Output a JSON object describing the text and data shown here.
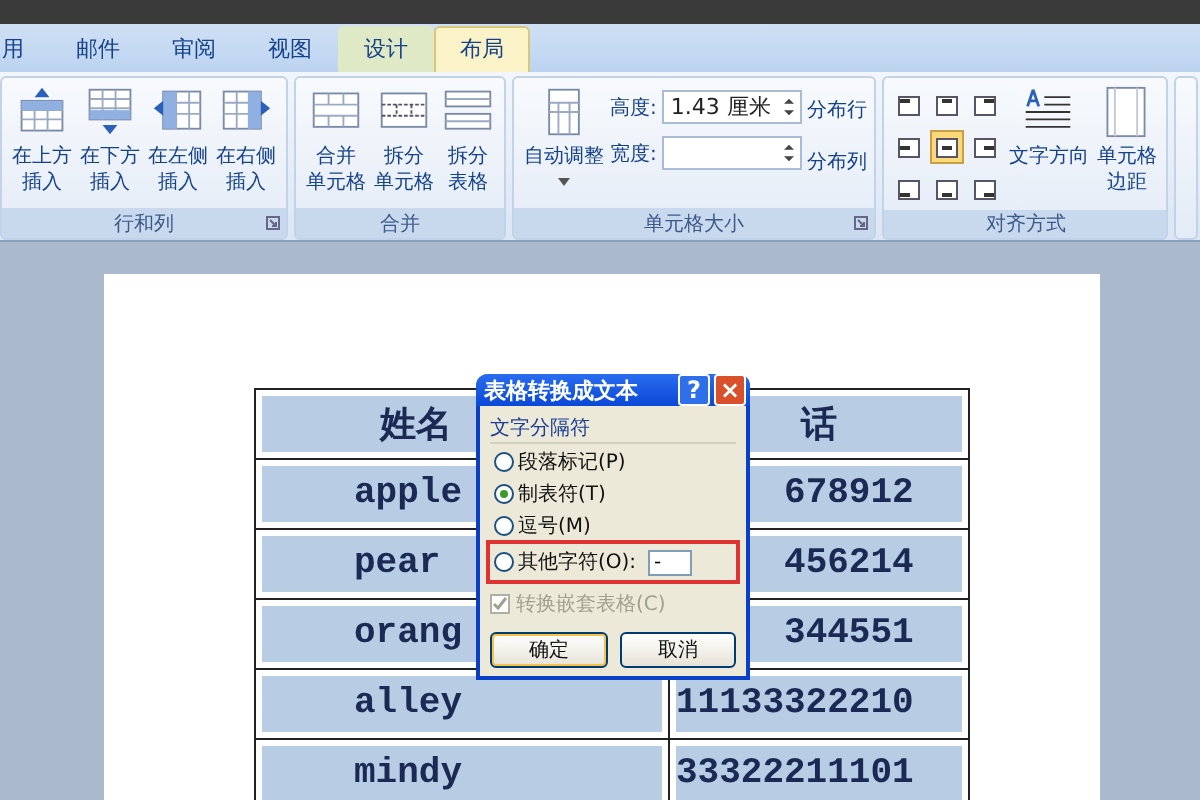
{
  "tabs": [
    {
      "label": "用",
      "selected": false,
      "context": false
    },
    {
      "label": "邮件",
      "selected": false,
      "context": false
    },
    {
      "label": "审阅",
      "selected": false,
      "context": false
    },
    {
      "label": "视图",
      "selected": false,
      "context": false
    },
    {
      "label": "设计",
      "selected": false,
      "context": true
    },
    {
      "label": "布局",
      "selected": true,
      "context": true
    }
  ],
  "ribbon": {
    "groups": [
      {
        "kind": "buttons",
        "label": "行和列",
        "items": [
          {
            "lines": [
              "在上方",
              "插入"
            ]
          },
          {
            "lines": [
              "在下方",
              "插入"
            ]
          },
          {
            "lines": [
              "在左侧",
              "插入"
            ]
          },
          {
            "lines": [
              "在右侧",
              "插入"
            ]
          }
        ]
      },
      {
        "kind": "buttons",
        "label": "合并",
        "items": [
          {
            "lines": [
              "合并",
              "单元格"
            ]
          },
          {
            "lines": [
              "拆分",
              "单元格"
            ]
          },
          {
            "lines": [
              "拆分",
              "表格"
            ]
          }
        ]
      },
      {
        "kind": "size",
        "label": "单元格大小",
        "autofit": "自动调整",
        "fields": [
          {
            "label": "高度:",
            "value": "1.43 厘米"
          },
          {
            "label": "宽度:"
          }
        ],
        "distribute": [
          "分布行",
          "分布列"
        ]
      },
      {
        "kind": "align",
        "label": "对齐方式",
        "cells": [
          {
            "selected": false
          },
          {
            "selected": false
          },
          {
            "selected": false
          },
          {
            "selected": false
          },
          {
            "selected": true
          },
          {
            "selected": false
          },
          {
            "selected": false
          },
          {
            "selected": false
          },
          {
            "selected": false
          }
        ],
        "items": [
          {
            "lines": [
              "文字方向"
            ]
          },
          {
            "lines": [
              "单元格",
              "边距"
            ]
          }
        ]
      }
    ]
  },
  "table": {
    "rows": [
      {
        "header": true,
        "cells": [
          "姓名",
          "话"
        ]
      },
      {
        "header": false,
        "cells": [
          "apple",
          "678912"
        ]
      },
      {
        "header": false,
        "cells": [
          "pear",
          "456214"
        ]
      },
      {
        "header": false,
        "cells": [
          "orang",
          "344551"
        ]
      },
      {
        "header": false,
        "cells": [
          "alley",
          "11133322210"
        ]
      },
      {
        "header": false,
        "cells": [
          "mindy",
          "33322211101"
        ]
      }
    ]
  },
  "dialog": {
    "title": "表格转换成文本",
    "help": "?",
    "close": "×",
    "group": "文字分隔符",
    "options": [
      {
        "label": "段落标记(P)",
        "selected": false,
        "highlighted": false
      },
      {
        "label": "制表符(T)",
        "selected": true,
        "highlighted": false
      },
      {
        "label": "逗号(M)",
        "selected": false,
        "highlighted": false
      },
      {
        "label": "其他字符(O):",
        "selected": false,
        "highlighted": true,
        "value": "-"
      }
    ],
    "nested": {
      "label": "转换嵌套表格(C)",
      "checked": true,
      "disabled": true
    },
    "buttons": [
      {
        "label": "确定",
        "default": true
      },
      {
        "label": "取消",
        "default": false
      }
    ]
  }
}
